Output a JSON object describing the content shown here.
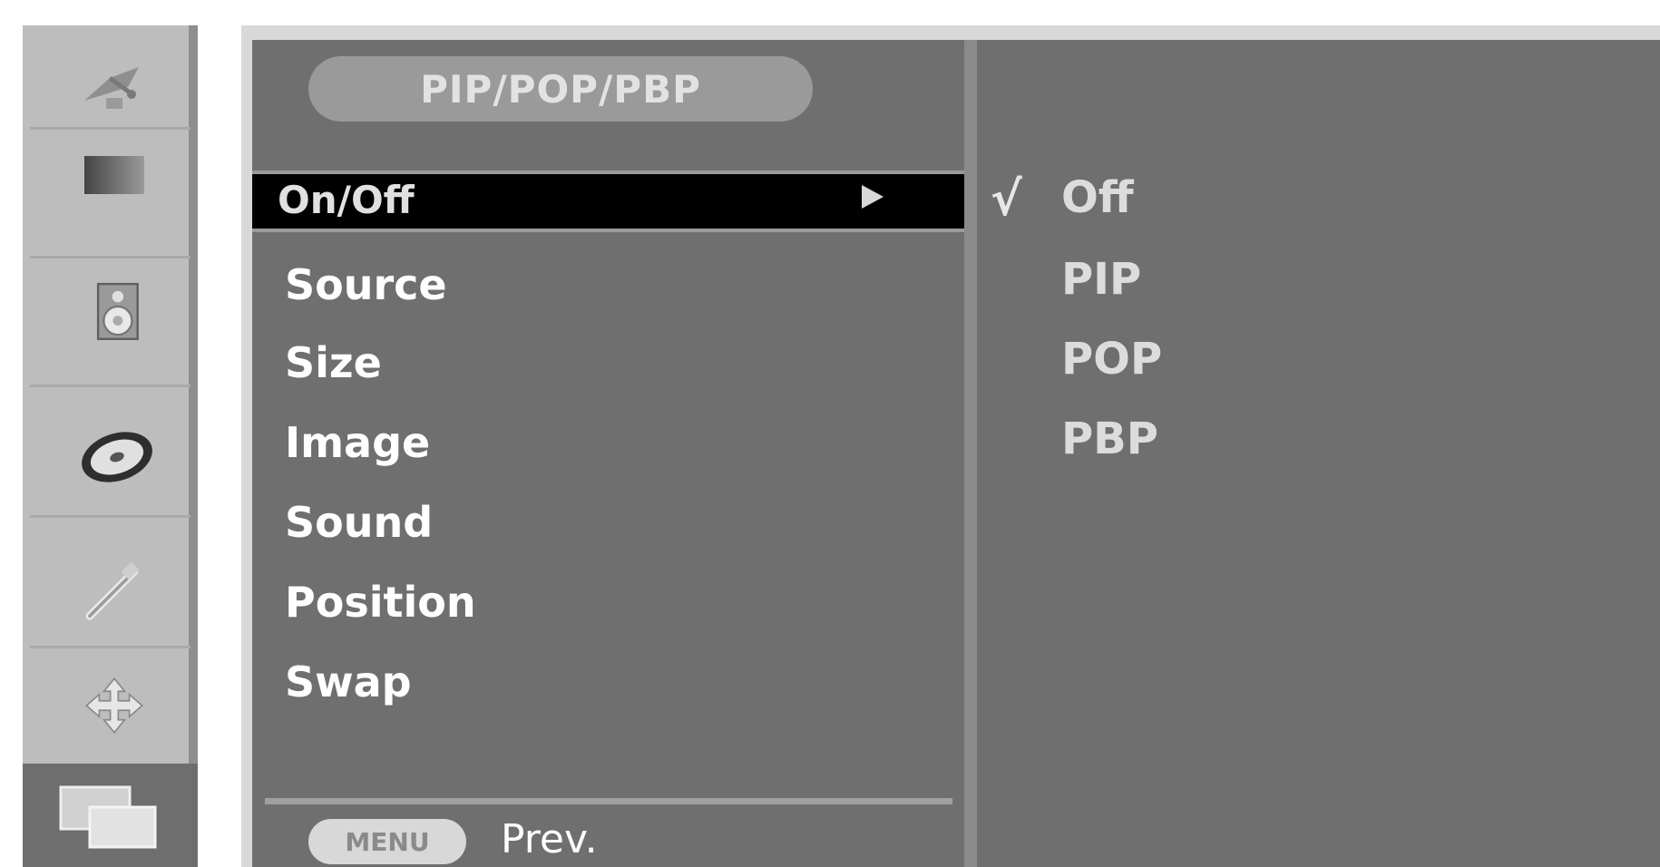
{
  "rail": {
    "icons": [
      "satellite-dish-icon",
      "picture-icon",
      "speaker-icon",
      "disc-icon",
      "tools-icon",
      "arrows-icon",
      "pip-windows-icon"
    ],
    "active_index": 6
  },
  "menu": {
    "title": "PIP/POP/PBP",
    "selected_item": "On/Off",
    "items": [
      "Source",
      "Size",
      "Image",
      "Sound",
      "Position",
      "Swap"
    ]
  },
  "submenu": {
    "options": [
      "Off",
      "PIP",
      "POP",
      "PBP"
    ],
    "checked": "Off",
    "check_glyph": "√"
  },
  "footer": {
    "key_label": "MENU",
    "action_label": "Prev."
  },
  "colors": {
    "panel": "#6f6f6f",
    "rail": "#bdbdbd",
    "selected_bg": "#000000"
  }
}
